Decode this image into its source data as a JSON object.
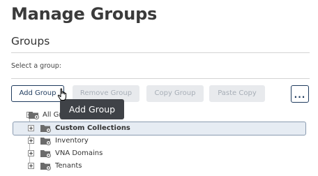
{
  "header": {
    "title": "Manage Groups",
    "section_title": "Groups",
    "select_label": "Select a group:"
  },
  "toolbar": {
    "add_group": "Add Group",
    "remove_group": "Remove Group",
    "copy_group": "Copy Group",
    "paste_copy": "Paste Copy",
    "more": "..."
  },
  "tooltip": {
    "text": "Add Group"
  },
  "tree": {
    "root": {
      "label": "All Gr",
      "expanded": true
    },
    "children": [
      {
        "label": "Custom Collections",
        "selected": true
      },
      {
        "label": "Inventory",
        "selected": false
      },
      {
        "label": "VNA Domains",
        "selected": false
      },
      {
        "label": "Tenants",
        "selected": false
      }
    ]
  },
  "colors": {
    "accent": "#1f3b5e",
    "tooltip_bg": "#3f4247",
    "selected_bg": "#e6ecf3",
    "disabled_bg": "#e8eaed"
  }
}
